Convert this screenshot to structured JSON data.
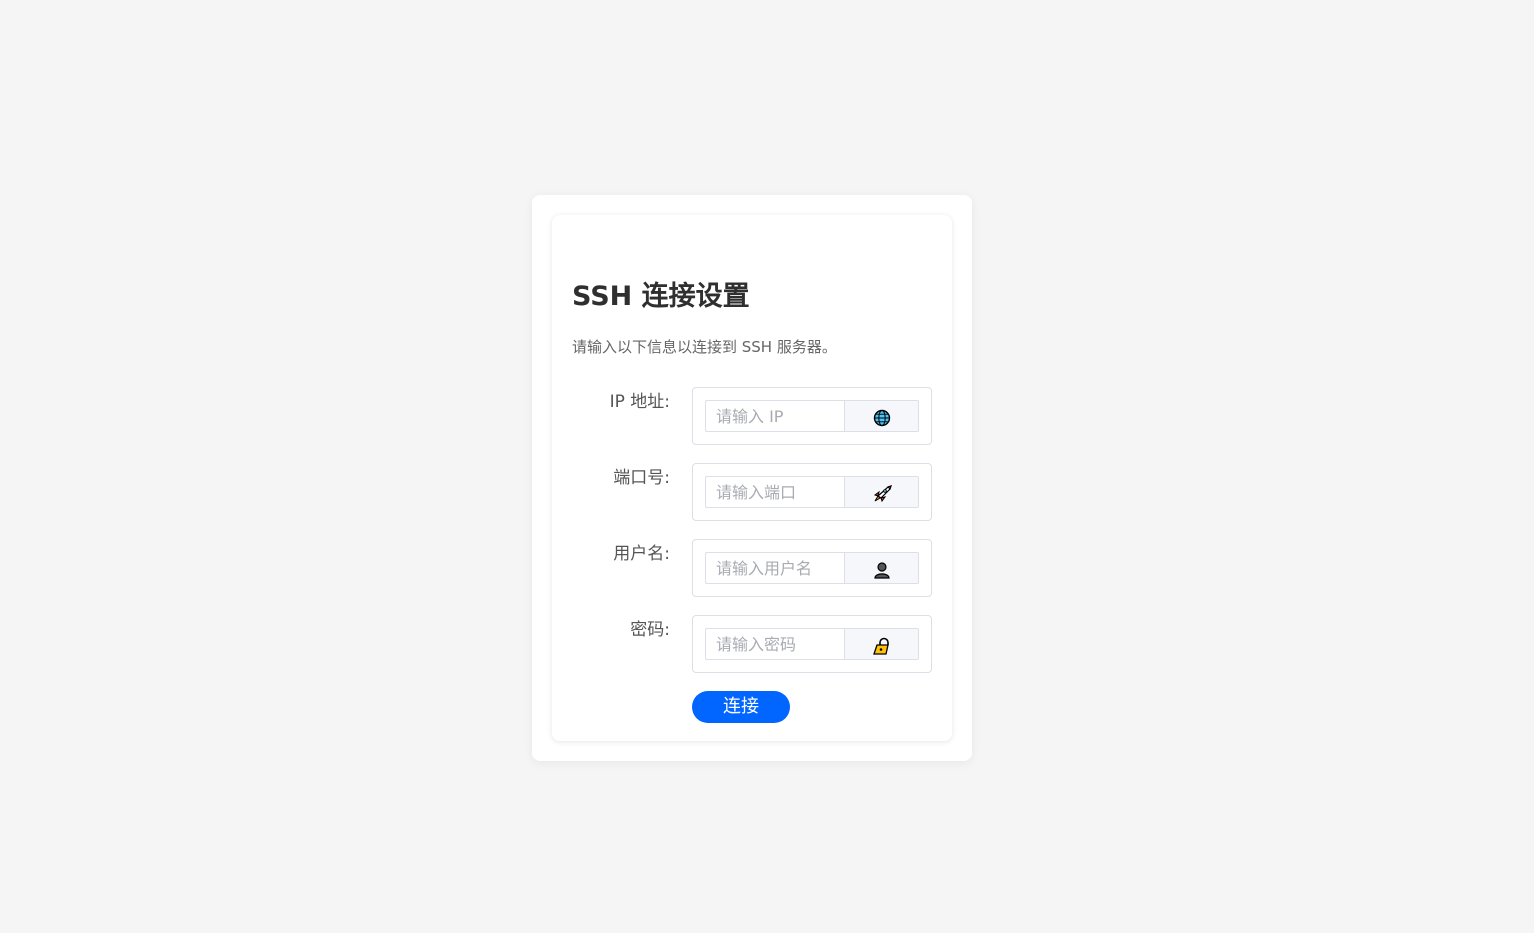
{
  "form": {
    "title": "SSH 连接设置",
    "subtitle": "请输入以下信息以连接到 SSH 服务器。",
    "fields": [
      {
        "label": "IP 地址:",
        "placeholder": "请输入 IP",
        "value": "",
        "icon": "globe-icon"
      },
      {
        "label": "端口号:",
        "placeholder": "请输入端口",
        "value": "",
        "icon": "rocket-icon"
      },
      {
        "label": "用户名:",
        "placeholder": "请输入用户名",
        "value": "",
        "icon": "user-icon"
      },
      {
        "label": "密码:",
        "placeholder": "请输入密码",
        "value": "",
        "icon": "lock-icon"
      }
    ],
    "submit_label": "连接"
  },
  "colors": {
    "page_background": "#f5f5f5",
    "primary": "#0066ff",
    "title": "#2f2f2f",
    "subtitle": "#666666",
    "border": "#dcdfe6",
    "placeholder": "#a8abb2"
  }
}
